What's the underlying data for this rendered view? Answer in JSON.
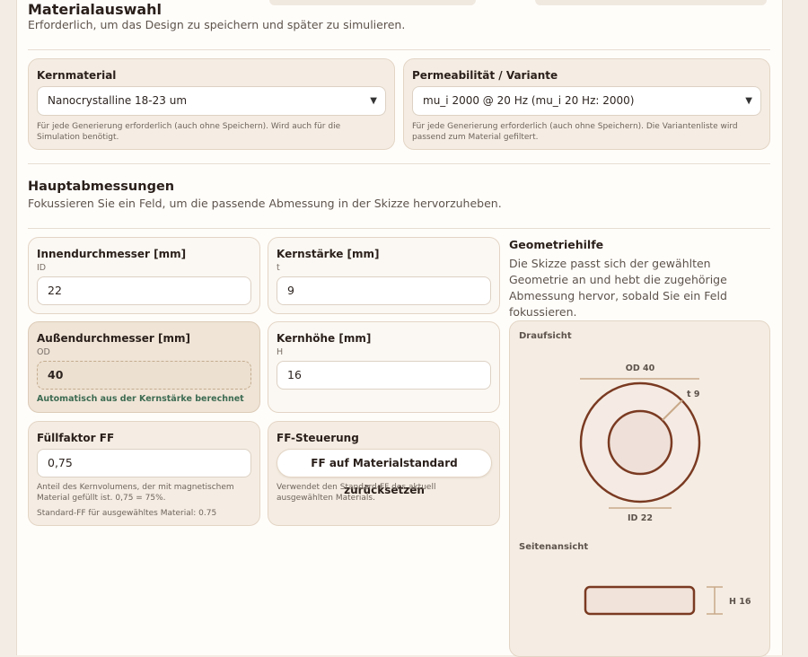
{
  "material_section": {
    "title": "Materialauswahl",
    "subtitle": "Erforderlich, um das Design zu speichern und später zu simulieren.",
    "core_material": {
      "label": "Kernmaterial",
      "selected": "Nanocrystalline 18-23 um",
      "help": "Für jede Generierung erforderlich (auch ohne Speichern). Wird auch für die Simulation benötigt."
    },
    "permeability": {
      "label": "Permeabilität / Variante",
      "selected": "mu_i 2000 @ 20 Hz (mu_i 20 Hz: 2000)",
      "help": "Für jede Generierung erforderlich (auch ohne Speichern). Die Variantenliste wird passend zum Material gefiltert."
    }
  },
  "dimensions_section": {
    "title": "Hauptabmessungen",
    "subtitle": "Fokussieren Sie ein Feld, um die passende Abmessung in der Skizze hervorzuheben.",
    "inner_diameter": {
      "label": "Innendurchmesser [mm]",
      "code": "ID",
      "value": "22"
    },
    "thickness": {
      "label": "Kernstärke [mm]",
      "code": "t",
      "value": "9"
    },
    "outer_diameter": {
      "label": "Außendurchmesser [mm]",
      "code": "OD",
      "value": "40",
      "note": "Automatisch aus der Kernstärke berechnet"
    },
    "height": {
      "label": "Kernhöhe [mm]",
      "code": "H",
      "value": "16"
    },
    "fill_factor": {
      "label": "Füllfaktor FF",
      "value": "0,75",
      "help": "Anteil des Kernvolumens, der mit magnetischem Material gefüllt ist. 0,75 = 75%.",
      "default_note": "Standard-FF für ausgewähltes Material: 0.75"
    },
    "ff_control": {
      "label": "FF-Steuerung",
      "button": "FF auf Materialstandard zurücksetzen",
      "help": "Verwendet den Standard-FF des aktuell ausgewählten Materials."
    }
  },
  "geometry_help": {
    "title": "Geometriehilfe",
    "text": "Die Skizze passt sich der gewählten Geometrie an und hebt die zugehörige Abmessung hervor, sobald Sie ein Feld fokussieren.",
    "top_view": {
      "title": "Draufsicht",
      "od_label": "OD 40",
      "t_label": "t 9",
      "id_label": "ID 22"
    },
    "side_view": {
      "title": "Seitenansicht",
      "h_label": "H 16"
    }
  },
  "colors": {
    "accent": "#7a3a22",
    "background": "#f3ece4",
    "card": "#fbf8f3",
    "note_green": "#3d6b52"
  }
}
